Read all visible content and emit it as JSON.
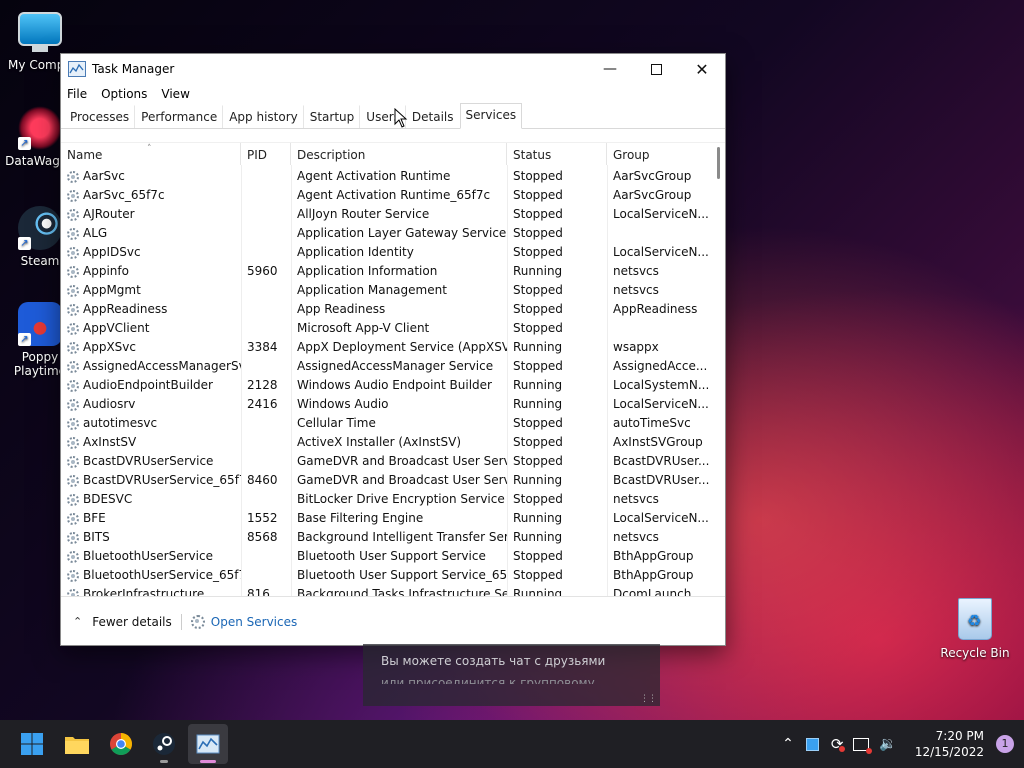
{
  "desktop": {
    "icons": [
      {
        "label": "My Compu"
      },
      {
        "label": "DataWagon"
      },
      {
        "label": "Steam"
      },
      {
        "label": "Poppy Playtime"
      }
    ],
    "recycle_bin": "Recycle Bin"
  },
  "window": {
    "title": "Task Manager",
    "menu": [
      "File",
      "Options",
      "View"
    ],
    "tabs": [
      "Processes",
      "Performance",
      "App history",
      "Startup",
      "Users",
      "Details",
      "Services"
    ],
    "active_tab": "Services",
    "columns": [
      "Name",
      "PID",
      "Description",
      "Status",
      "Group"
    ],
    "rows": [
      [
        "AarSvc",
        "",
        "Agent Activation Runtime",
        "Stopped",
        "AarSvcGroup"
      ],
      [
        "AarSvc_65f7c",
        "",
        "Agent Activation Runtime_65f7c",
        "Stopped",
        "AarSvcGroup"
      ],
      [
        "AJRouter",
        "",
        "AllJoyn Router Service",
        "Stopped",
        "LocalServiceN..."
      ],
      [
        "ALG",
        "",
        "Application Layer Gateway Service",
        "Stopped",
        ""
      ],
      [
        "AppIDSvc",
        "",
        "Application Identity",
        "Stopped",
        "LocalServiceN..."
      ],
      [
        "Appinfo",
        "5960",
        "Application Information",
        "Running",
        "netsvcs"
      ],
      [
        "AppMgmt",
        "",
        "Application Management",
        "Stopped",
        "netsvcs"
      ],
      [
        "AppReadiness",
        "",
        "App Readiness",
        "Stopped",
        "AppReadiness"
      ],
      [
        "AppVClient",
        "",
        "Microsoft App-V Client",
        "Stopped",
        ""
      ],
      [
        "AppXSvc",
        "3384",
        "AppX Deployment Service (AppXSVC)",
        "Running",
        "wsappx"
      ],
      [
        "AssignedAccessManagerSvc",
        "",
        "AssignedAccessManager Service",
        "Stopped",
        "AssignedAcce..."
      ],
      [
        "AudioEndpointBuilder",
        "2128",
        "Windows Audio Endpoint Builder",
        "Running",
        "LocalSystemN..."
      ],
      [
        "Audiosrv",
        "2416",
        "Windows Audio",
        "Running",
        "LocalServiceN..."
      ],
      [
        "autotimesvc",
        "",
        "Cellular Time",
        "Stopped",
        "autoTimeSvc"
      ],
      [
        "AxInstSV",
        "",
        "ActiveX Installer (AxInstSV)",
        "Stopped",
        "AxInstSVGroup"
      ],
      [
        "BcastDVRUserService",
        "",
        "GameDVR and Broadcast User Service",
        "Stopped",
        "BcastDVRUser..."
      ],
      [
        "BcastDVRUserService_65f7c",
        "8460",
        "GameDVR and Broadcast User Servic...",
        "Running",
        "BcastDVRUser..."
      ],
      [
        "BDESVC",
        "",
        "BitLocker Drive Encryption Service",
        "Stopped",
        "netsvcs"
      ],
      [
        "BFE",
        "1552",
        "Base Filtering Engine",
        "Running",
        "LocalServiceN..."
      ],
      [
        "BITS",
        "8568",
        "Background Intelligent Transfer Servi...",
        "Running",
        "netsvcs"
      ],
      [
        "BluetoothUserService",
        "",
        "Bluetooth User Support Service",
        "Stopped",
        "BthAppGroup"
      ],
      [
        "BluetoothUserService_65f7c",
        "",
        "Bluetooth User Support Service_65f7c",
        "Stopped",
        "BthAppGroup"
      ],
      [
        "BrokerInfrastructure",
        "816",
        "Background Tasks Infrastructure Serv...",
        "Running",
        "DcomLaunch"
      ]
    ],
    "footer": {
      "fewer_details": "Fewer details",
      "open_services": "Open Services"
    }
  },
  "chat_popup": {
    "line1": "Вы можете создать чат с друзьями",
    "line2": "или присоединится к групповому"
  },
  "taskbar": {
    "time": "7:20 PM",
    "date": "12/15/2022",
    "notification_count": "1"
  }
}
